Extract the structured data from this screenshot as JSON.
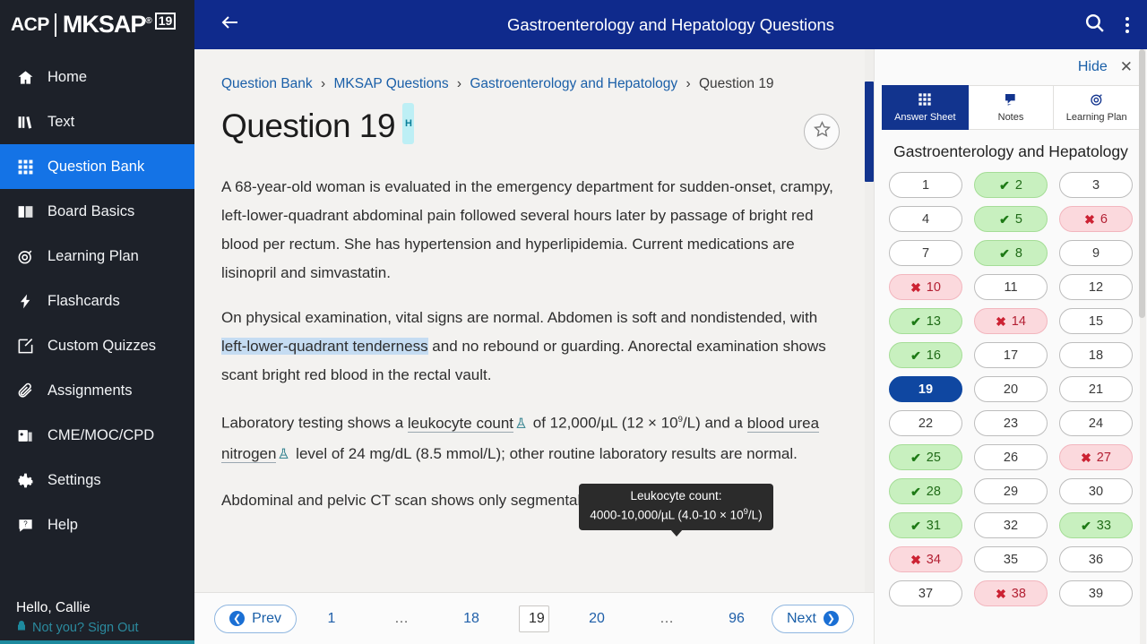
{
  "brand": {
    "acp": "ACP",
    "mksap": "MKSAP",
    "registered": "®",
    "edition": "19"
  },
  "sidebar": {
    "items": [
      {
        "label": "Home",
        "icon": "home-icon",
        "active": false
      },
      {
        "label": "Text",
        "icon": "book-stack-icon",
        "active": false
      },
      {
        "label": "Question Bank",
        "icon": "grid-icon",
        "active": true
      },
      {
        "label": "Board Basics",
        "icon": "open-book-icon",
        "active": false
      },
      {
        "label": "Learning Plan",
        "icon": "target-icon",
        "active": false
      },
      {
        "label": "Flashcards",
        "icon": "bolt-icon",
        "active": false
      },
      {
        "label": "Custom Quizzes",
        "icon": "pencil-square-icon",
        "active": false
      },
      {
        "label": "Assignments",
        "icon": "paperclip-icon",
        "active": false
      },
      {
        "label": "CME/MOC/CPD",
        "icon": "certificate-icon",
        "active": false
      },
      {
        "label": "Settings",
        "icon": "gear-icon",
        "active": false
      },
      {
        "label": "Help",
        "icon": "help-chat-icon",
        "active": false
      }
    ],
    "greeting": "Hello, Callie",
    "signout": "Not you? Sign Out"
  },
  "topbar": {
    "title": "Gastroenterology and Hepatology Questions",
    "back_icon": "back-arrow-icon",
    "search_icon": "search-icon",
    "menu_icon": "kebab-menu-icon"
  },
  "breadcrumb": {
    "items": [
      "Question Bank",
      "MKSAP Questions",
      "Gastroenterology and Hepatology",
      "Question 19"
    ],
    "separator": "›"
  },
  "question": {
    "title": "Question 19",
    "badge": "H",
    "star_icon": "star-outline-icon",
    "paragraphs": [
      "A 68-year-old woman is evaluated in the emergency department for sudden-onset, crampy, left-lower-quadrant abdominal pain followed several hours later by passage of bright red blood per rectum. She has hypertension and hyperlipidemia. Current medications are lisinopril and simvastatin.",
      "Abdominal and pelvic CT scan shows only segmental thickening of the"
    ],
    "exam_p_pre": "On physical examination, vital signs are normal. Abdomen is soft and nondistended, with ",
    "exam_p_selected": "left-lower-quadrant tenderness",
    "exam_p_post": " and no rebound or guarding. Anorectal examination shows scant bright red blood in the rectal vault.",
    "lab_pre": "Laboratory testing shows a ",
    "lab_link1": "leukocyte count",
    "lab_mid1": " of 12,000/µL (12 × 10",
    "lab_mid1_sup": "9",
    "lab_mid1_end": "/L) and a ",
    "lab_link2": "blood urea nitrogen",
    "lab_post": " level of 24 mg/dL (8.5 mmol/L); other routine laboratory results are normal.",
    "flask_icon": "flask-icon"
  },
  "tooltip": {
    "line1": "Leukocyte count:",
    "line2_pre": "4000-10,000/µL (4.0-10 × 10",
    "line2_sup": "9",
    "line2_post": "/L)"
  },
  "fab": {
    "icon": "highlighter-pen-icon"
  },
  "pagination": {
    "prev": "Prev",
    "next": "Next",
    "prev_icon": "circle-left-arrow-icon",
    "next_icon": "circle-right-arrow-icon",
    "pages": [
      "1",
      "…",
      "18",
      "19",
      "20",
      "…",
      "96"
    ],
    "current": "19"
  },
  "right_panel": {
    "hide_label": "Hide",
    "close_icon": "close-icon",
    "tabs": [
      {
        "label": "Answer Sheet",
        "icon": "grid-icon",
        "active": true
      },
      {
        "label": "Notes",
        "icon": "note-icon",
        "active": false
      },
      {
        "label": "Learning Plan",
        "icon": "target-icon",
        "active": false
      }
    ],
    "section_title": "Gastroenterology and Hepatology",
    "marks": {
      "correct": "✔",
      "wrong": "✖"
    },
    "questions": [
      {
        "n": "1",
        "state": "none"
      },
      {
        "n": "2",
        "state": "correct"
      },
      {
        "n": "3",
        "state": "none"
      },
      {
        "n": "4",
        "state": "none"
      },
      {
        "n": "5",
        "state": "correct"
      },
      {
        "n": "6",
        "state": "wrong"
      },
      {
        "n": "7",
        "state": "none"
      },
      {
        "n": "8",
        "state": "correct"
      },
      {
        "n": "9",
        "state": "none"
      },
      {
        "n": "10",
        "state": "wrong"
      },
      {
        "n": "11",
        "state": "none"
      },
      {
        "n": "12",
        "state": "none"
      },
      {
        "n": "13",
        "state": "correct"
      },
      {
        "n": "14",
        "state": "wrong"
      },
      {
        "n": "15",
        "state": "none"
      },
      {
        "n": "16",
        "state": "correct"
      },
      {
        "n": "17",
        "state": "none"
      },
      {
        "n": "18",
        "state": "none"
      },
      {
        "n": "19",
        "state": "current"
      },
      {
        "n": "20",
        "state": "none"
      },
      {
        "n": "21",
        "state": "none"
      },
      {
        "n": "22",
        "state": "none"
      },
      {
        "n": "23",
        "state": "none"
      },
      {
        "n": "24",
        "state": "none"
      },
      {
        "n": "25",
        "state": "correct"
      },
      {
        "n": "26",
        "state": "none"
      },
      {
        "n": "27",
        "state": "wrong"
      },
      {
        "n": "28",
        "state": "correct"
      },
      {
        "n": "29",
        "state": "none"
      },
      {
        "n": "30",
        "state": "none"
      },
      {
        "n": "31",
        "state": "correct"
      },
      {
        "n": "32",
        "state": "none"
      },
      {
        "n": "33",
        "state": "correct"
      },
      {
        "n": "34",
        "state": "wrong"
      },
      {
        "n": "35",
        "state": "none"
      },
      {
        "n": "36",
        "state": "none"
      },
      {
        "n": "37",
        "state": "none"
      },
      {
        "n": "38",
        "state": "wrong"
      },
      {
        "n": "39",
        "state": "none"
      }
    ]
  },
  "colors": {
    "sidebar_bg": "#1d2129",
    "sidebar_active": "#1473e6",
    "topbar_bg": "#0f2a8c",
    "panel_tab_active": "#12348e",
    "correct_bg": "#c8f0bf",
    "wrong_bg": "#fbd9dd",
    "current_bg": "#0f47a1",
    "link": "#1a5fa8",
    "teal": "#1d8a9e",
    "badge_bg": "#bdeff5"
  }
}
